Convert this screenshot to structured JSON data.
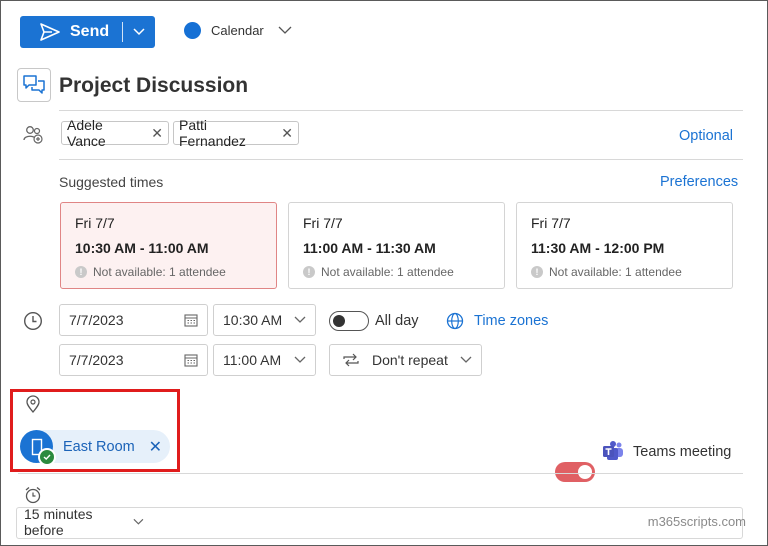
{
  "toolbar": {
    "send_label": "Send",
    "calendar_label": "Calendar",
    "calendar_color": "#1570d5"
  },
  "meeting": {
    "title": "Project Discussion"
  },
  "attendees": {
    "chips": [
      "Adele Vance",
      "Patti Fernandez"
    ],
    "optional_label": "Optional"
  },
  "suggested": {
    "heading": "Suggested times",
    "preferences_label": "Preferences",
    "slots": [
      {
        "day": "Fri 7/7",
        "time": "10:30 AM - 11:00 AM",
        "note": "Not available: 1 attendee"
      },
      {
        "day": "Fri 7/7",
        "time": "11:00 AM - 11:30 AM",
        "note": "Not available: 1 attendee"
      },
      {
        "day": "Fri 7/7",
        "time": "11:30 AM - 12:00 PM",
        "note": "Not available: 1 attendee"
      }
    ]
  },
  "datetime": {
    "start_date": "7/7/2023",
    "start_time": "10:30 AM",
    "end_date": "7/7/2023",
    "end_time": "11:00 AM",
    "all_day_label": "All day",
    "time_zones_label": "Time zones",
    "repeat_label": "Don't repeat"
  },
  "location": {
    "room_label": "East Room"
  },
  "teams": {
    "label": "Teams meeting"
  },
  "reminder": {
    "value": "15 minutes before"
  },
  "watermark": "m365scripts.com",
  "colors": {
    "accent": "#1b73d3",
    "highlight_box": "#e01c1c",
    "teams_toggle": "#e06064"
  }
}
